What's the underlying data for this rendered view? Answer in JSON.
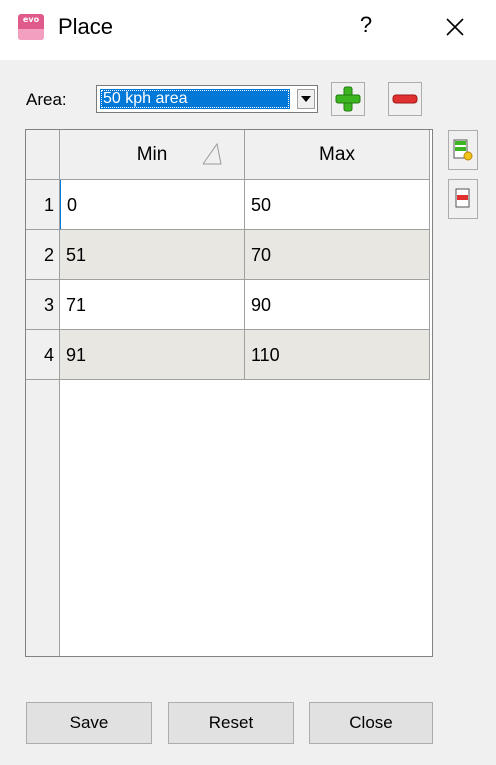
{
  "window": {
    "title": "Place",
    "help_label": "?",
    "app_icon_text": "evo"
  },
  "toolbar": {
    "area_label": "Area:",
    "area_value": "50 kph area"
  },
  "grid": {
    "columns": [
      "Min",
      "Max"
    ],
    "rows": [
      {
        "num": "1",
        "min": "0",
        "max": "50"
      },
      {
        "num": "2",
        "min": "51",
        "max": "70"
      },
      {
        "num": "3",
        "min": "71",
        "max": "90"
      },
      {
        "num": "4",
        "min": "91",
        "max": "110"
      }
    ]
  },
  "buttons": {
    "save": "Save",
    "reset": "Reset",
    "close": "Close"
  },
  "icons": {
    "add": "plus-icon",
    "remove": "minus-icon",
    "add_row": "add-row-icon",
    "delete_row": "delete-row-icon",
    "sort": "sort-indicator-icon"
  },
  "colors": {
    "selection": "#0078d7",
    "alt_row": "#e9e7e2",
    "add_green": "#3cb521",
    "remove_red": "#e03030",
    "app_icon": "#e05a8c"
  }
}
